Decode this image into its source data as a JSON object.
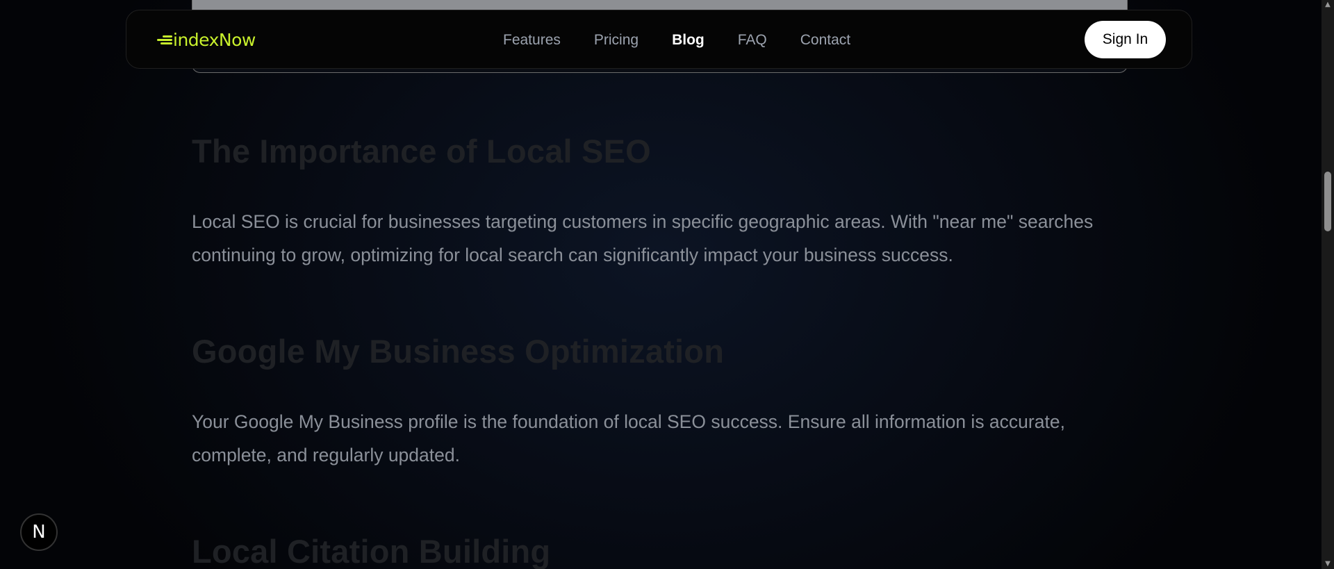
{
  "header": {
    "logo_text": "indexNow",
    "nav": [
      {
        "label": "Features"
      },
      {
        "label": "Pricing"
      },
      {
        "label": "Blog",
        "active": true
      },
      {
        "label": "FAQ"
      },
      {
        "label": "Contact"
      }
    ],
    "signin_label": "Sign In"
  },
  "article": {
    "sections": [
      {
        "heading": "The Importance of Local SEO",
        "body": "Local SEO is crucial for businesses targeting customers in specific geographic areas. With \"near me\" searches continuing to grow, optimizing for local search can significantly impact your business success."
      },
      {
        "heading": "Google My Business Optimization",
        "body": "Your Google My Business profile is the foundation of local SEO success. Ensure all information is accurate, complete, and regularly updated."
      },
      {
        "heading": "Local Citation Building",
        "body": ""
      }
    ]
  },
  "badge": {
    "letter": "N"
  },
  "colors": {
    "accent": "#c8f02c",
    "nav_inactive": "#9ca3af",
    "heading": "#1f2125",
    "body_text": "#8b9099"
  },
  "icons": {
    "logo_mark": "speed-lines-icon",
    "scroll_up": "triangle-up-icon",
    "scroll_down": "triangle-down-icon"
  }
}
